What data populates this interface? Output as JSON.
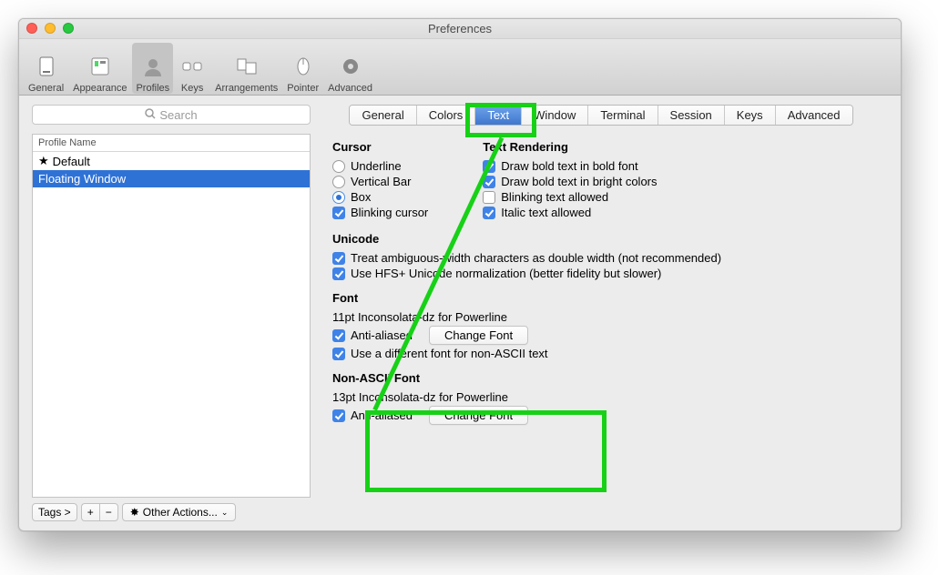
{
  "window": {
    "title": "Preferences"
  },
  "toolbar": [
    {
      "name": "general",
      "label": "General"
    },
    {
      "name": "appearance",
      "label": "Appearance"
    },
    {
      "name": "profiles",
      "label": "Profiles",
      "selected": true
    },
    {
      "name": "keys",
      "label": "Keys"
    },
    {
      "name": "arrangements",
      "label": "Arrangements"
    },
    {
      "name": "pointer",
      "label": "Pointer"
    },
    {
      "name": "advanced",
      "label": "Advanced"
    }
  ],
  "search": {
    "placeholder": "Search"
  },
  "profile_list": {
    "header": "Profile Name",
    "items": [
      {
        "label": "Default",
        "starred": true,
        "selected": false
      },
      {
        "label": "Floating Window",
        "starred": false,
        "selected": true
      }
    ]
  },
  "bottom": {
    "tags": "Tags >",
    "plus": "+",
    "minus": "−",
    "other": "Other Actions..."
  },
  "tabs": [
    "General",
    "Colors",
    "Text",
    "Window",
    "Terminal",
    "Session",
    "Keys",
    "Advanced"
  ],
  "active_tab": "Text",
  "text_panel": {
    "cursor": {
      "title": "Cursor",
      "underline": "Underline",
      "vertical": "Vertical Bar",
      "box": "Box",
      "blinking": "Blinking cursor"
    },
    "rendering": {
      "title": "Text Rendering",
      "bold_font": "Draw bold text in bold font",
      "bright": "Draw bold text in bright colors",
      "blinking": "Blinking text allowed",
      "italic": "Italic text allowed"
    },
    "unicode": {
      "title": "Unicode",
      "ambiguous": "Treat ambiguous-width characters as double width (not recommended)",
      "hfs": "Use HFS+ Unicode normalization (better fidelity but slower)"
    },
    "font": {
      "title": "Font",
      "desc": "11pt Inconsolata-dz for Powerline",
      "aa": "Anti-aliased",
      "change": "Change Font",
      "diff": "Use a different font for non-ASCII text"
    },
    "nonascii": {
      "title": "Non-ASCII Font",
      "desc": "13pt Inconsolata-dz for Powerline",
      "aa": "Anti-aliased",
      "change": "Change Font"
    }
  }
}
